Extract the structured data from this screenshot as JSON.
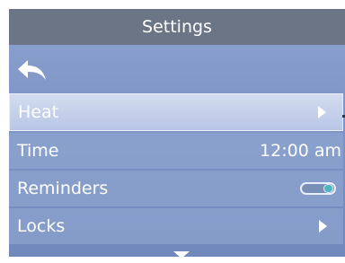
{
  "screen": {
    "title": "Settings"
  },
  "nav": {
    "back_icon": "back-arrow-icon"
  },
  "menu": {
    "items": [
      {
        "label": "Heat",
        "value": "",
        "control": "chevron-right-icon",
        "selected": true
      },
      {
        "label": "Time",
        "value": "12:00 am",
        "control": "",
        "selected": false
      },
      {
        "label": "Reminders",
        "value": "",
        "control": "toggle",
        "toggle_on": true,
        "selected": false
      },
      {
        "label": "Locks",
        "value": "",
        "control": "chevron-right-icon",
        "selected": false
      }
    ]
  },
  "footer": {
    "scroll_icon": "chevron-down-icon"
  },
  "colors": {
    "title_bar": "#6c7585",
    "background": "#7e95c6",
    "selected_row": "#c4d0ea",
    "toggle_knob": "#4fb5c1",
    "text": "#ffffff"
  }
}
